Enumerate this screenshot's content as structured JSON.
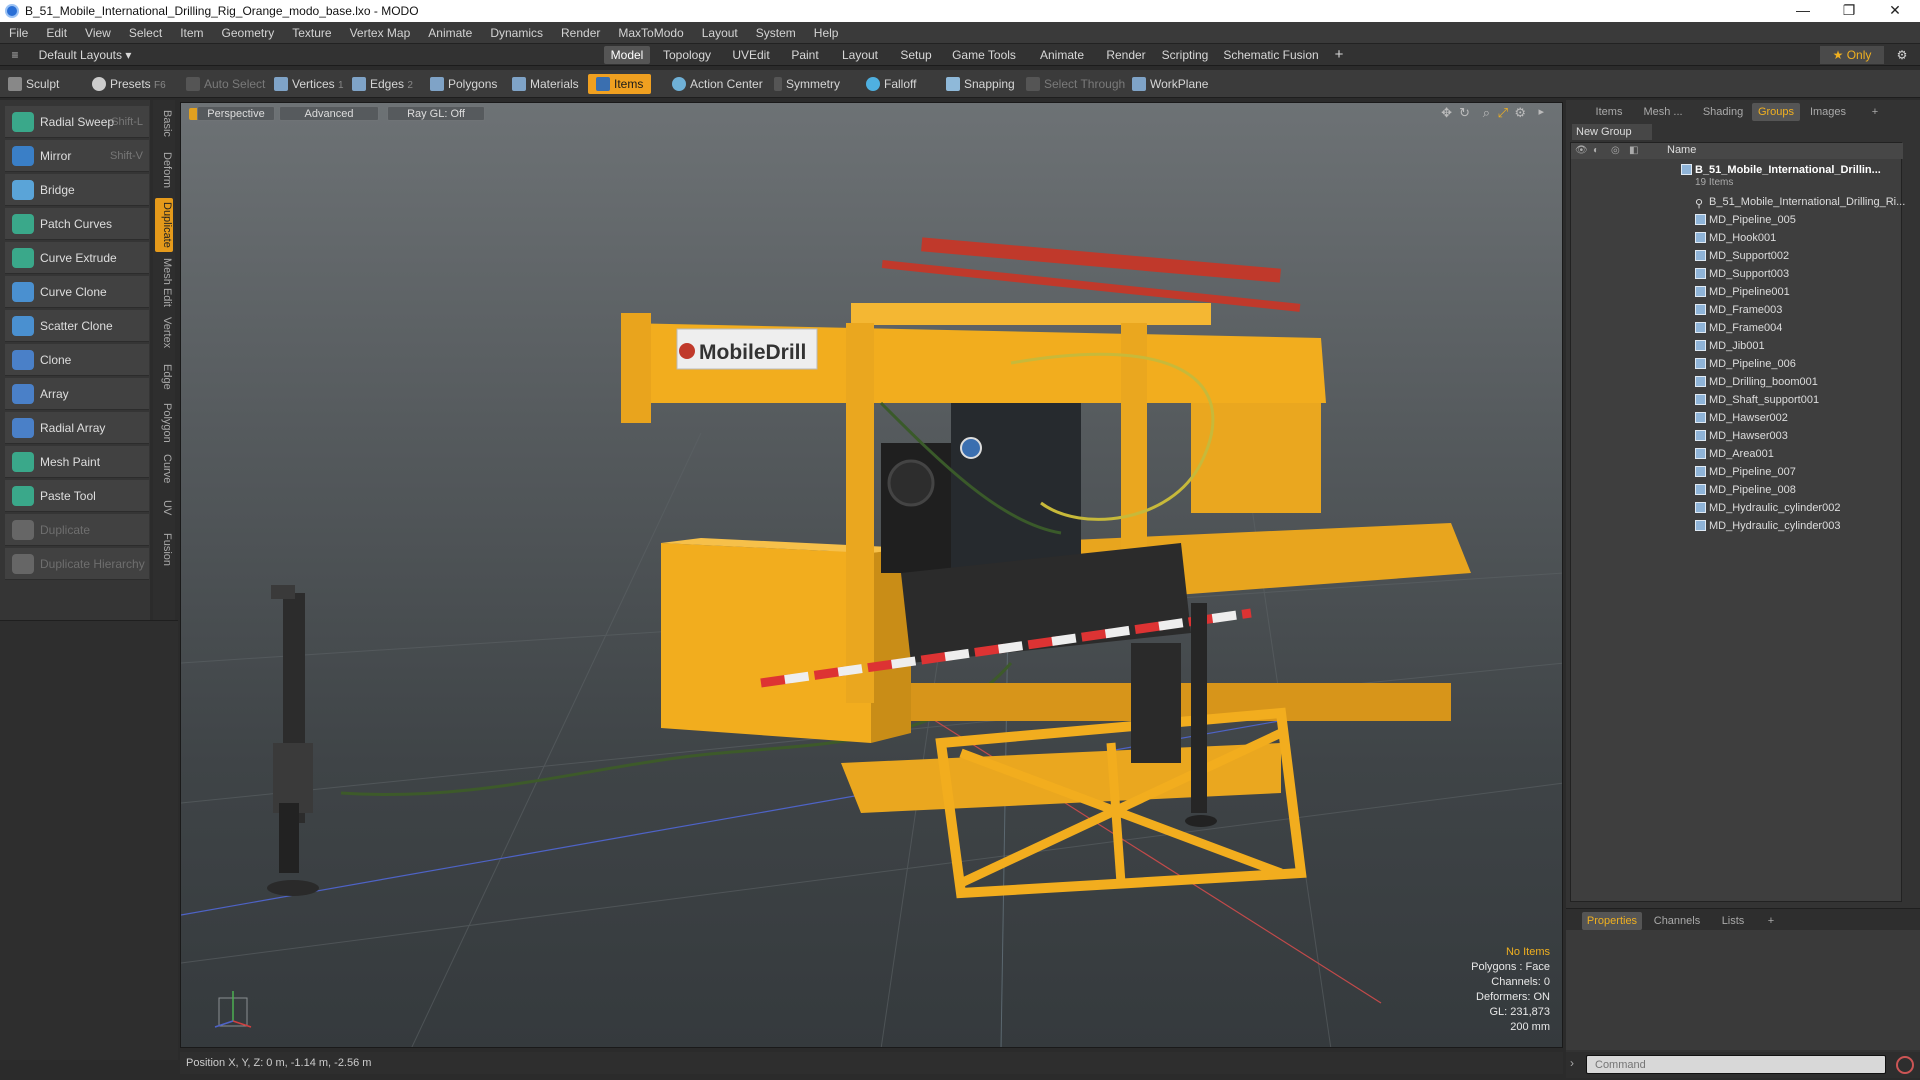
{
  "window": {
    "title": "B_51_Mobile_International_Drilling_Rig_Orange_modo_base.lxo - MODO",
    "minimize": "—",
    "maximize": "❐",
    "close": "✕"
  },
  "menu": [
    "File",
    "Edit",
    "View",
    "Select",
    "Item",
    "Geometry",
    "Texture",
    "Vertex Map",
    "Animate",
    "Dynamics",
    "Render",
    "MaxToModo",
    "Layout",
    "System",
    "Help"
  ],
  "layoutbar": {
    "layouts_label": "Default Layouts ▾",
    "tabs": [
      "Model",
      "Topology",
      "UVEdit",
      "Paint",
      "Layout",
      "Setup",
      "Game Tools",
      "Animate",
      "Render",
      "Scripting",
      "Schematic Fusion"
    ],
    "active_tab": "Model",
    "add": "+",
    "only_label": "★ Only",
    "gear": "⚙"
  },
  "toolbar": {
    "sculpt": "Sculpt",
    "presets": "Presets",
    "presets_key": "F6",
    "auto_select": "Auto Select",
    "vertices": "Vertices",
    "vertices_count": "1",
    "edges": "Edges",
    "edges_count": "2",
    "polygons": "Polygons",
    "materials": "Materials",
    "items": "Items",
    "action_center": "Action Center",
    "symmetry": "Symmetry",
    "falloff": "Falloff",
    "snapping": "Snapping",
    "select_through": "Select Through",
    "workplane": "WorkPlane"
  },
  "tools": [
    {
      "label": "Radial Sweep",
      "shortcut": "Shift-L",
      "enabled": true
    },
    {
      "label": "Mirror",
      "shortcut": "Shift-V",
      "enabled": true
    },
    {
      "label": "Bridge",
      "shortcut": "",
      "enabled": true
    },
    {
      "label": "Patch Curves",
      "shortcut": "",
      "enabled": true
    },
    {
      "label": "Curve Extrude",
      "shortcut": "",
      "enabled": true
    },
    {
      "label": "Curve Clone",
      "shortcut": "",
      "enabled": true
    },
    {
      "label": "Scatter Clone",
      "shortcut": "",
      "enabled": true
    },
    {
      "label": "Clone",
      "shortcut": "",
      "enabled": true
    },
    {
      "label": "Array",
      "shortcut": "",
      "enabled": true
    },
    {
      "label": "Radial Array",
      "shortcut": "",
      "enabled": true
    },
    {
      "label": "Mesh Paint",
      "shortcut": "",
      "enabled": true
    },
    {
      "label": "Paste Tool",
      "shortcut": "",
      "enabled": true
    },
    {
      "label": "Duplicate",
      "shortcut": "",
      "enabled": false
    },
    {
      "label": "Duplicate Hierarchy",
      "shortcut": "",
      "enabled": false
    }
  ],
  "vtabs": [
    "Basic",
    "Deform",
    "Duplicate",
    "Mesh Edit",
    "Vertex",
    "Edge",
    "Polygon",
    "Curve",
    "UV",
    "Fusion"
  ],
  "vtab_active": "Duplicate",
  "viewport": {
    "tabs": [
      "Perspective",
      "Advanced",
      "Ray GL: Off"
    ],
    "info": {
      "selection": "No Items",
      "polygons": "Polygons : Face",
      "channels": "Channels: 0",
      "deformers": "Deformers: ON",
      "gl": "GL: 231,873",
      "scale": "200 mm"
    },
    "sign_text": "MobileDrill"
  },
  "rightpanel": {
    "tabs": [
      "Items",
      "Mesh ...",
      "Shading",
      "Groups",
      "Images"
    ],
    "active_tab": "Groups",
    "add": "+",
    "new_group": "New Group",
    "name_header": "Name",
    "group_name": "B_51_Mobile_International_Drillin...",
    "group_count": "19 Items",
    "items": [
      "B_51_Mobile_International_Drilling_Ri...",
      "MD_Pipeline_005",
      "MD_Hook001",
      "MD_Support002",
      "MD_Support003",
      "MD_Pipeline001",
      "MD_Frame003",
      "MD_Frame004",
      "MD_Jib001",
      "MD_Pipeline_006",
      "MD_Drilling_boom001",
      "MD_Shaft_support001",
      "MD_Hawser002",
      "MD_Hawser003",
      "MD_Area001",
      "MD_Pipeline_007",
      "MD_Pipeline_008",
      "MD_Hydraulic_cylinder002",
      "MD_Hydraulic_cylinder003"
    ],
    "bottom_tabs": [
      "Properties",
      "Channels",
      "Lists"
    ],
    "bottom_active": "Properties",
    "command_placeholder": "Command"
  },
  "status": {
    "position": "Position X, Y, Z:  0 m, -1.14 m, -2.56 m"
  },
  "colors": {
    "accent": "#f0a020",
    "rig_yellow": "#f2ad1e",
    "bg": "#2b2b2b"
  }
}
